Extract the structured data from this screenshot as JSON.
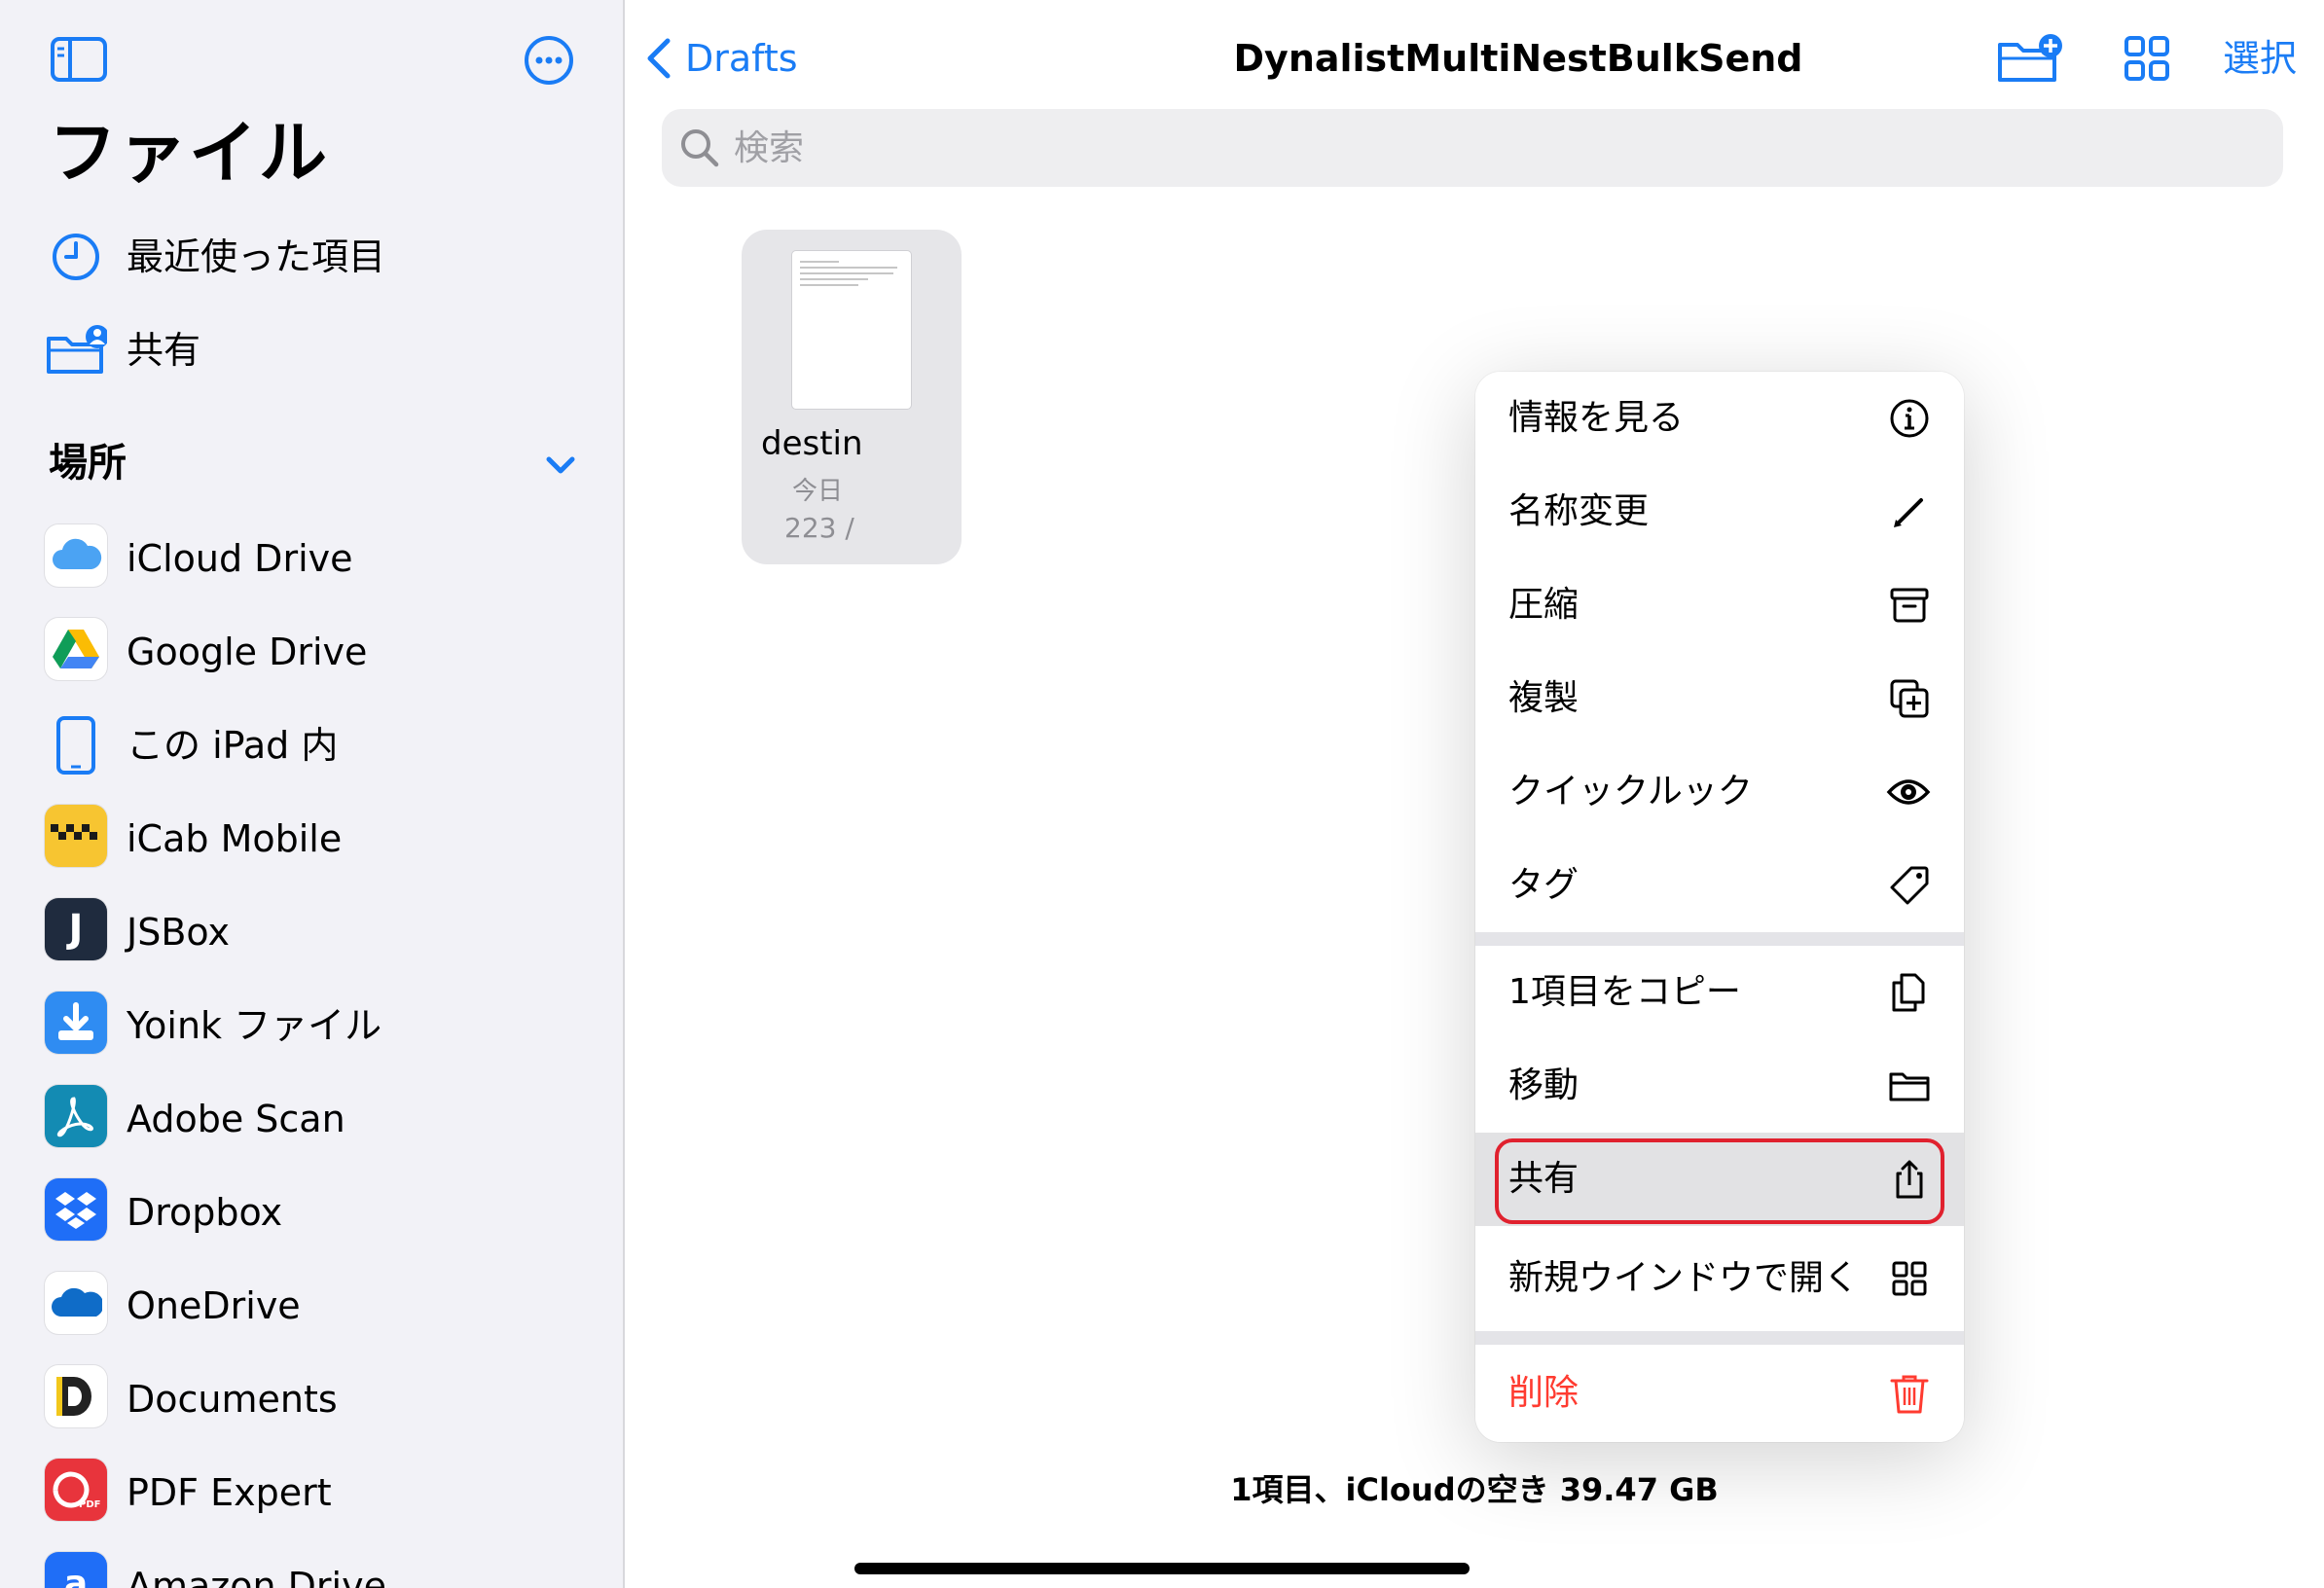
{
  "sidebar": {
    "title": "ファイル",
    "items": [
      {
        "label": "最近使った項目",
        "icon": "clock-icon"
      },
      {
        "label": "共有",
        "icon": "shared-folder-icon"
      }
    ],
    "locations_header": "場所",
    "locations": [
      {
        "label": "iCloud Drive",
        "icon": "icloud-drive-icon"
      },
      {
        "label": "Google Drive",
        "icon": "google-drive-icon"
      },
      {
        "label": "この iPad 内",
        "icon": "ipad-icon"
      },
      {
        "label": "iCab Mobile",
        "icon": "icab-mobile-icon"
      },
      {
        "label": "JSBox",
        "icon": "jsbox-icon"
      },
      {
        "label": "Yoink ファイル",
        "icon": "yoink-icon"
      },
      {
        "label": "Adobe Scan",
        "icon": "adobe-scan-icon"
      },
      {
        "label": "Dropbox",
        "icon": "dropbox-icon"
      },
      {
        "label": "OneDrive",
        "icon": "onedrive-icon"
      },
      {
        "label": "Documents",
        "icon": "documents-icon"
      },
      {
        "label": "PDF Expert",
        "icon": "pdf-expert-icon"
      },
      {
        "label": "Amazon Drive",
        "icon": "amazon-drive-icon"
      }
    ]
  },
  "header": {
    "back_label": "Drafts",
    "title": "DynalistMultiNestBulkSend",
    "select_label": "選択"
  },
  "search": {
    "placeholder": "検索"
  },
  "file": {
    "name": "destin",
    "date": "今日",
    "size": "223 /"
  },
  "context_menu": {
    "group1": [
      {
        "label": "情報を見る",
        "icon": "info-icon"
      },
      {
        "label": "名称変更",
        "icon": "pencil-icon"
      },
      {
        "label": "圧縮",
        "icon": "archive-box-icon"
      },
      {
        "label": "複製",
        "icon": "duplicate-icon"
      },
      {
        "label": "クイックルック",
        "icon": "eye-icon"
      },
      {
        "label": "タグ",
        "icon": "tag-icon"
      }
    ],
    "group2": [
      {
        "label": "1項目をコピー",
        "icon": "copy-icon"
      },
      {
        "label": "移動",
        "icon": "folder-icon"
      },
      {
        "label": "共有",
        "icon": "share-icon"
      },
      {
        "label": "新規ウインドウで開く",
        "icon": "grid-icon"
      }
    ],
    "group3": [
      {
        "label": "削除",
        "icon": "trash-icon"
      }
    ]
  },
  "footer": {
    "status": "1項目、iCloudの空き 39.47 GB"
  },
  "colors": {
    "accent": "#1a7cf5",
    "danger": "#ff3b30",
    "highlight_ring": "#e0212e"
  }
}
